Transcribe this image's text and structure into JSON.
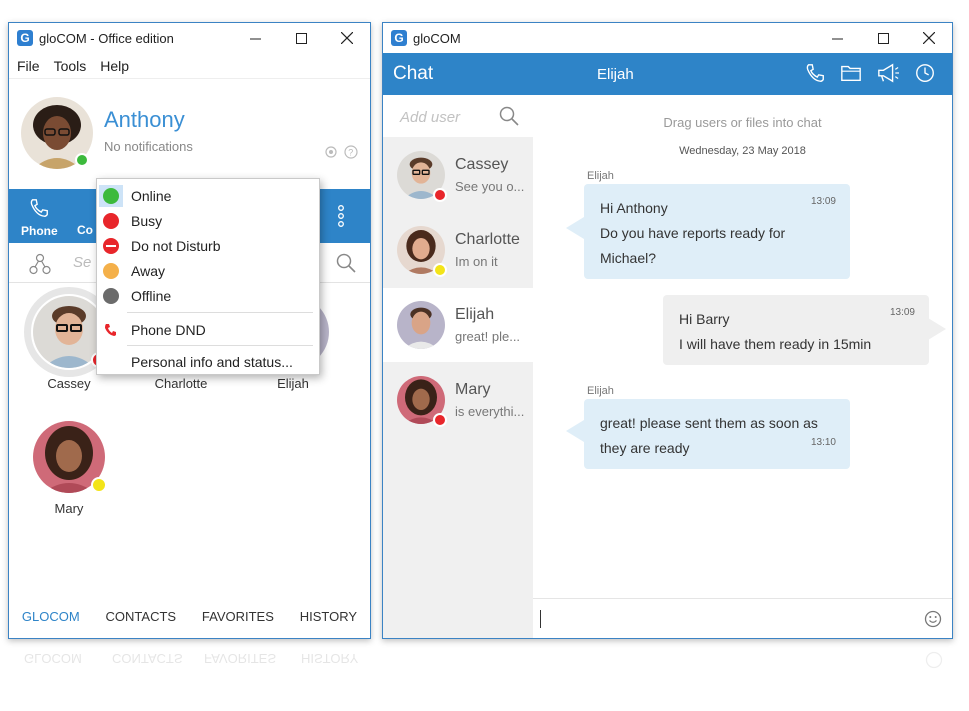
{
  "left_window": {
    "title": "gloCOM - Office edition",
    "logo_letter": "G",
    "menu": [
      "File",
      "Tools",
      "Help"
    ],
    "profile": {
      "name": "Anthony",
      "subtitle": "No notifications",
      "status_color": "#3cba3c"
    },
    "toolbar": {
      "phone_label": "Phone",
      "contacts_label_partial": "Co"
    },
    "search_placeholder_partial": "Se",
    "contacts": [
      {
        "name": "Cassey",
        "status_color": "#e8262b"
      },
      {
        "name": "Charlotte",
        "status_color": "#f3e419"
      },
      {
        "name": "Elijah",
        "status_color": ""
      },
      {
        "name": "Mary",
        "status_color": "#f3e419"
      }
    ],
    "bottom_nav": [
      "GLOCOM",
      "CONTACTS",
      "FAVORITES",
      "HISTORY"
    ],
    "status_menu": {
      "items": [
        {
          "label": "Online",
          "color": "#3cba3c"
        },
        {
          "label": "Busy",
          "color": "#e8262b"
        },
        {
          "label": "Do not Disturb",
          "color": "#e8262b"
        },
        {
          "label": "Away",
          "color": "#f4b04a"
        },
        {
          "label": "Offline",
          "color": "#6b6b6b"
        }
      ],
      "phone_dnd": "Phone DND",
      "personal_info": "Personal info and status..."
    }
  },
  "right_window": {
    "title": "gloCOM",
    "logo_letter": "G",
    "header": {
      "title": "Chat",
      "peer": "Elijah"
    },
    "add_user_placeholder": "Add user",
    "conversations": [
      {
        "name": "Cassey",
        "preview": "See you o...",
        "status_color": "#e8262b"
      },
      {
        "name": "Charlotte",
        "preview": "Im on it",
        "status_color": "#f3e419"
      },
      {
        "name": "Elijah",
        "preview": "great! ple...",
        "status_color": ""
      },
      {
        "name": "Mary",
        "preview": "is everythi...",
        "status_color": "#e8262b"
      }
    ],
    "chat": {
      "hint": "Drag users or files into chat",
      "date": "Wednesday, 23 May 2018",
      "messages": [
        {
          "sender": "Elijah",
          "line1": "Hi Anthony",
          "line2": "Do you have reports ready for",
          "line3": "Michael?",
          "time": "13:09"
        },
        {
          "sender": "",
          "line1": "Hi Barry",
          "line2": "I will have them ready in 15min",
          "time": "13:09"
        },
        {
          "sender": "Elijah",
          "line1": "great! please sent them as soon as",
          "line2": "they are ready",
          "time": "13:10"
        }
      ]
    }
  },
  "colors": {
    "accent": "#2e84c8",
    "bubble_in": "#dfeef8",
    "bubble_out": "#efefef"
  }
}
